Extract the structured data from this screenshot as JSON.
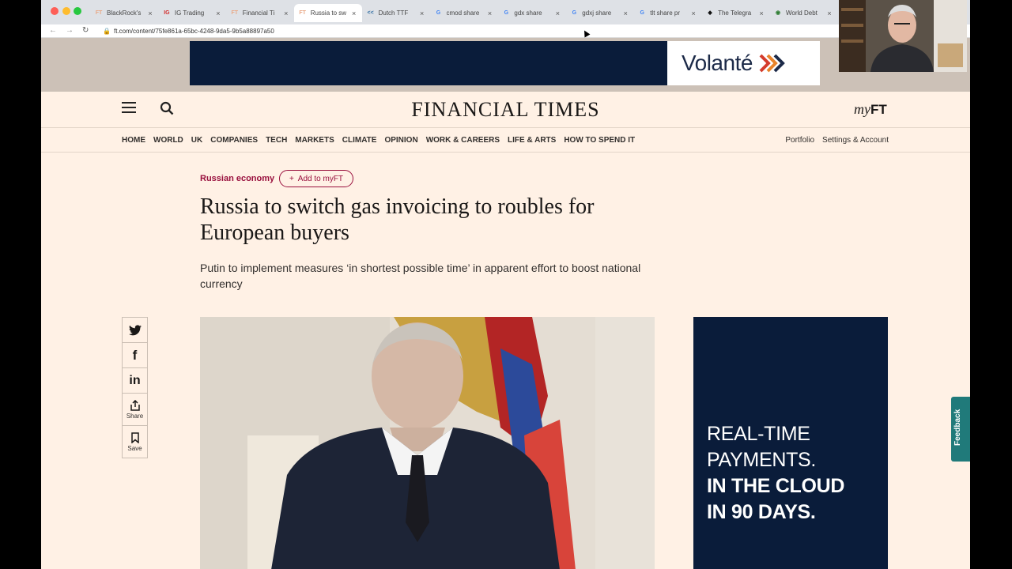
{
  "browser": {
    "tabs": [
      {
        "favicon": "FT",
        "title": "BlackRock's"
      },
      {
        "favicon": "IG",
        "title": "IG Trading"
      },
      {
        "favicon": "FT",
        "title": "Financial Ti"
      },
      {
        "favicon": "FT",
        "title": "Russia to sw"
      },
      {
        "favicon": "<<",
        "title": "Dutch TTF"
      },
      {
        "favicon": "G",
        "title": "cmod share"
      },
      {
        "favicon": "G",
        "title": "gdx share"
      },
      {
        "favicon": "G",
        "title": "gdxj share"
      },
      {
        "favicon": "G",
        "title": "tlt share pr"
      },
      {
        "favicon": "◆",
        "title": "The Telegra"
      },
      {
        "favicon": "◉",
        "title": "World Debt"
      }
    ],
    "active_tab_index": 3,
    "url": "ft.com/content/75fe861a-65bc-4248-9da5-9b5a88897a50"
  },
  "ad_banner": {
    "brand": "Volanté"
  },
  "header": {
    "masthead": "FINANCIAL TIMES",
    "myft_prefix": "my",
    "myft_suffix": "FT"
  },
  "nav": {
    "items": [
      "HOME",
      "WORLD",
      "UK",
      "COMPANIES",
      "TECH",
      "MARKETS",
      "CLIMATE",
      "OPINION",
      "WORK & CAREERS",
      "LIFE & ARTS",
      "HOW TO SPEND IT"
    ],
    "right": [
      "Portfolio",
      "Settings & Account"
    ]
  },
  "article": {
    "topic": "Russian economy",
    "add_myft": "Add to myFT",
    "headline": "Russia to switch gas invoicing to roubles for European buyers",
    "standfirst": "Putin to implement measures ‘in shortest possible time’ in apparent effort to boost national currency"
  },
  "share": {
    "share_label": "Share",
    "save_label": "Save"
  },
  "side_ad": {
    "line1": "REAL-TIME",
    "line2": "PAYMENTS.",
    "line3": "IN THE CLOUD",
    "line4": "IN 90 DAYS."
  },
  "feedback": {
    "label": "Feedback"
  },
  "colors": {
    "page_bg": "#fff1e5",
    "claret": "#990f3d",
    "ad_navy": "#0a1c3a",
    "feedback_teal": "#207a7a"
  }
}
